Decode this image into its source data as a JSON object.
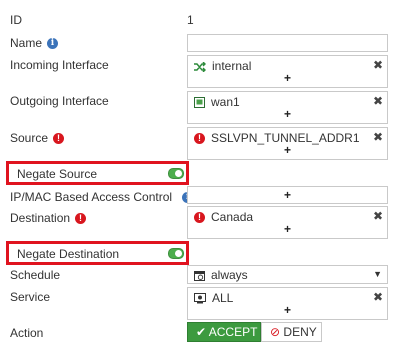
{
  "form": {
    "id": {
      "label": "ID",
      "value": "1"
    },
    "name": {
      "label": "Name",
      "value": ""
    },
    "incoming_interface": {
      "label": "Incoming Interface",
      "value": "internal"
    },
    "outgoing_interface": {
      "label": "Outgoing Interface",
      "value": "wan1"
    },
    "source": {
      "label": "Source",
      "value": "SSLVPN_TUNNEL_ADDR1"
    },
    "negate_source": {
      "label": "Negate Source",
      "enabled": true
    },
    "ip_mac_access_control": {
      "label": "IP/MAC Based Access Control",
      "value": ""
    },
    "destination": {
      "label": "Destination",
      "value": "Canada"
    },
    "negate_destination": {
      "label": "Negate Destination",
      "enabled": true
    },
    "schedule": {
      "label": "Schedule",
      "value": "always"
    },
    "service": {
      "label": "Service",
      "value": "ALL"
    },
    "action": {
      "label": "Action",
      "accept_label": "ACCEPT",
      "deny_label": "DENY",
      "selected": "ACCEPT"
    }
  },
  "glyphs": {
    "plus": "+",
    "remove": "✖",
    "info": "i",
    "warn": "!",
    "check": "✔",
    "deny": "⊘",
    "caret": "▼"
  },
  "colors": {
    "accept_green": "#3c9a3f",
    "highlight_red": "#e0131f",
    "warn_red": "#d8161e",
    "info_blue": "#3b73b9",
    "toggle_green": "#4cae4c"
  }
}
